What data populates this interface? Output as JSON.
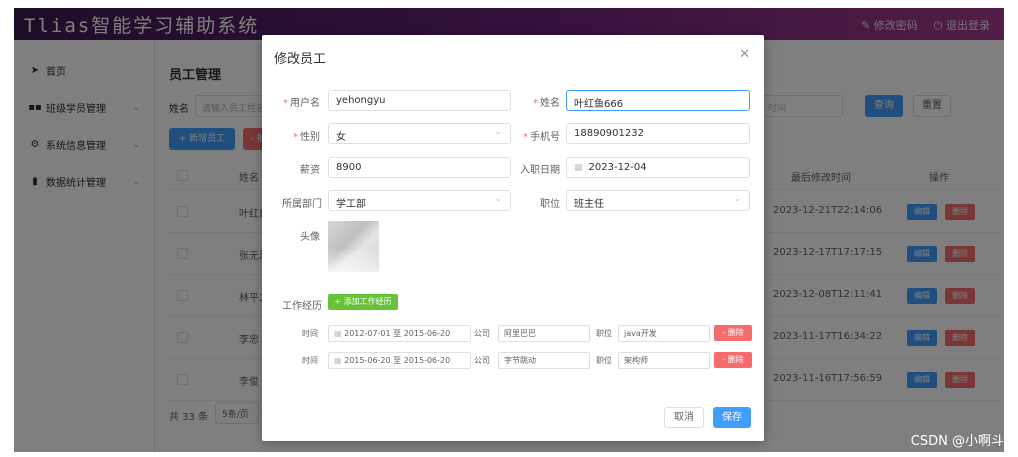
{
  "app": {
    "title": "Tlias智能学习辅助系统",
    "change_password": "修改密码",
    "logout": "退出登录"
  },
  "sidebar": {
    "items": [
      {
        "label": "首页",
        "icon": "send-icon"
      },
      {
        "label": "班级学员管理",
        "icon": "grid-icon"
      },
      {
        "label": "系统信息管理",
        "icon": "gear-icon"
      },
      {
        "label": "数据统计管理",
        "icon": "bar-chart-icon"
      }
    ]
  },
  "page": {
    "title": "员工管理",
    "search_label": "姓名",
    "search_placeholder": "请输入员工姓名",
    "time_placeholder": "时间",
    "query_button": "查询",
    "reset_button": "重置",
    "add_button": "+ 新增员工",
    "batch_delete_button": "- 批"
  },
  "table": {
    "headers": {
      "name": "姓名",
      "last_modified": "最后修改时间",
      "actions": "操作"
    },
    "edit_label": "编辑",
    "delete_label": "删除",
    "rows": [
      {
        "name": "叶红鱼",
        "last_modified": "2023-12-21T22:14:06"
      },
      {
        "name": "张无忌",
        "last_modified": "2023-12-17T17:17:15"
      },
      {
        "name": "林平之",
        "last_modified": "2023-12-08T12:11:41"
      },
      {
        "name": "李忠",
        "last_modified": "2023-11-17T16:34:22"
      },
      {
        "name": "李俊",
        "last_modified": "2023-11-16T17:56:59"
      }
    ]
  },
  "pagination": {
    "total": "共 33 条",
    "page_size": "5条/页"
  },
  "dialog": {
    "title": "修改员工",
    "username_label": "用户名",
    "username_value": "yehongyu",
    "name_label": "姓名",
    "name_value": "叶红鱼666",
    "gender_label": "性别",
    "gender_value": "女",
    "phone_label": "手机号",
    "phone_value": "18890901232",
    "salary_label": "薪资",
    "salary_value": "8900",
    "entry_date_label": "入职日期",
    "entry_date_value": "2023-12-04",
    "dept_label": "所属部门",
    "dept_value": "学工部",
    "job_label": "职位",
    "job_value": "班主任",
    "avatar_label": "头像",
    "work_exp_label": "工作经历",
    "add_exp_button": "+ 添加工作经历",
    "exp_time_label": "时间",
    "exp_to": "至",
    "exp_company_label": "公司",
    "exp_job_label": "职位",
    "exp_delete_button": "- 删除",
    "experiences": [
      {
        "start": "2012-07-01",
        "end": "2015-06-20",
        "company": "阿里巴巴",
        "job": "java开发"
      },
      {
        "start": "2015-06-20",
        "end": "2015-06-20",
        "company": "字节跳动",
        "job": "架构师"
      }
    ],
    "cancel_button": "取消",
    "save_button": "保存"
  },
  "watermark": "CSDN @小啊斗"
}
